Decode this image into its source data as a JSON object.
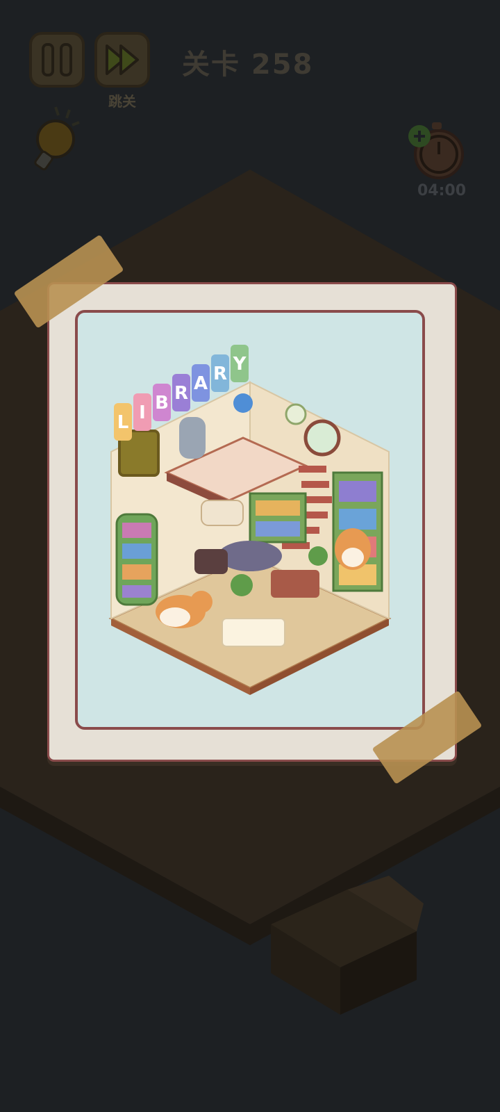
{
  "hud": {
    "skip_label": "跳关",
    "level_text": "关卡 258",
    "timer_text": "04:00"
  },
  "scene": {
    "sign_letters": [
      "L",
      "I",
      "B",
      "R",
      "A",
      "R",
      "Y"
    ],
    "sign_colors": [
      "#f3c46b",
      "#f09cb3",
      "#cf86d0",
      "#9a7fd6",
      "#7e93e0",
      "#82b6da",
      "#8fc58b"
    ]
  },
  "colors": {
    "overlay": "#1d2023",
    "card_border": "#8a4b4b",
    "card_bg": "#e6e0d6",
    "scene_bg": "#cfe5e5"
  }
}
